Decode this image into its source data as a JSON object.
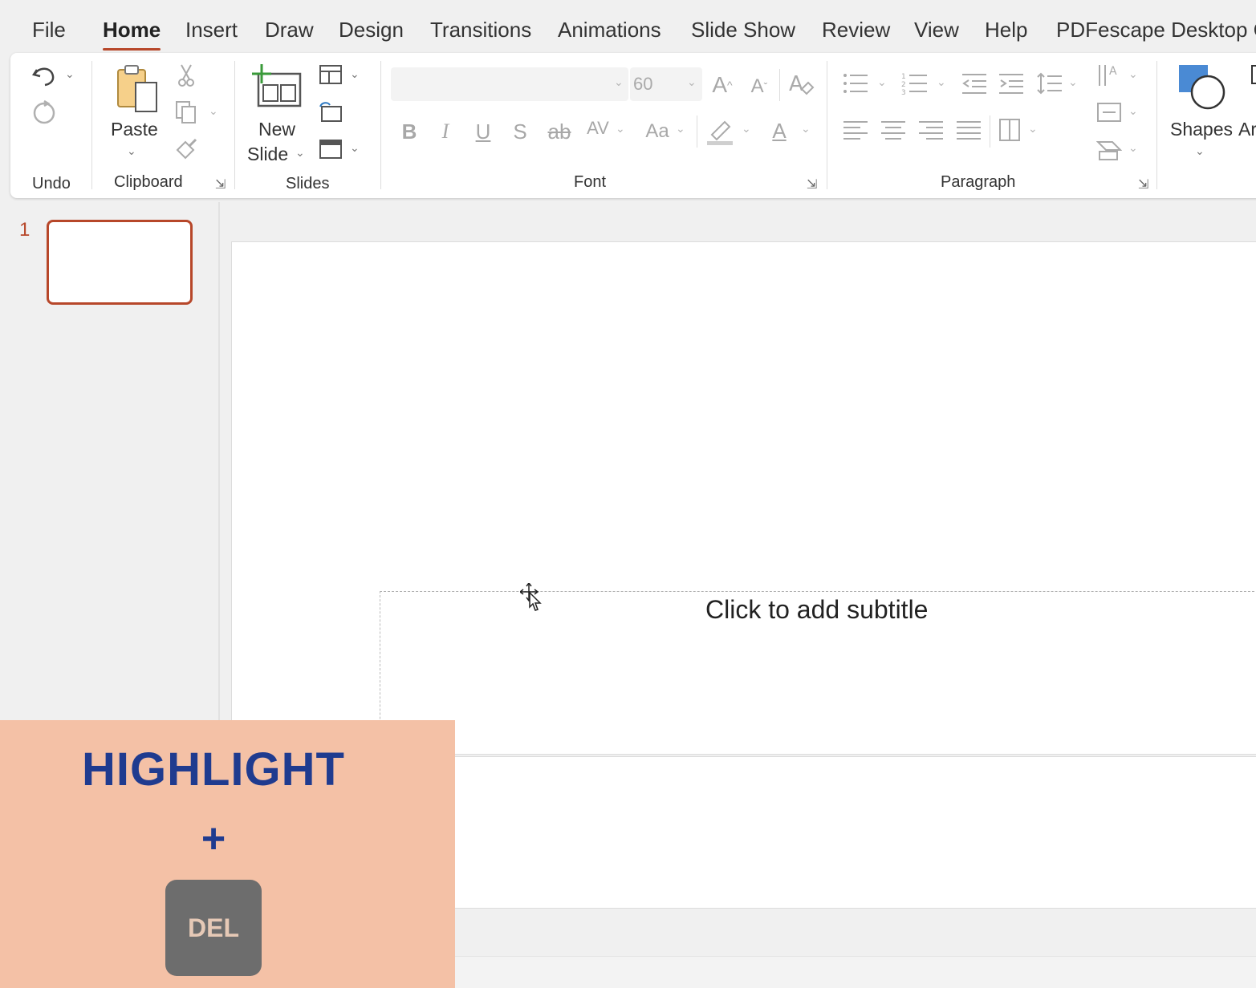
{
  "menu": {
    "tabs": [
      "File",
      "Home",
      "Insert",
      "Draw",
      "Design",
      "Transitions",
      "Animations",
      "Slide Show",
      "Review",
      "View",
      "Help",
      "PDFescape Desktop C"
    ],
    "active": "Home"
  },
  "ribbon": {
    "groups": {
      "undo": "Undo",
      "clipboard": "Clipboard",
      "slides": "Slides",
      "font": "Font",
      "paragraph": "Paragraph"
    },
    "paste_label": "Paste",
    "new_slide_line1": "New",
    "new_slide_line2": "Slide",
    "font_name": "",
    "font_size": "60",
    "shapes_label": "Shapes",
    "arrange_partial": "Ar",
    "glyphs": {
      "grow": "A",
      "shrink": "A",
      "bold": "B",
      "italic": "I",
      "underline": "U",
      "shadow": "S",
      "strike": "ab",
      "spacing": "AV",
      "case": "Aa",
      "color": "A"
    }
  },
  "thumbnails": [
    {
      "number": "1"
    }
  ],
  "slide": {
    "subtitle_placeholder": "Click to add subtitle"
  },
  "overlay": {
    "title": "HIGHLIGHT",
    "plus": "+",
    "key": "DEL",
    "background": "#f4c1a6",
    "text_color": "#1f3b8f"
  },
  "accent_color": "#b7472a"
}
